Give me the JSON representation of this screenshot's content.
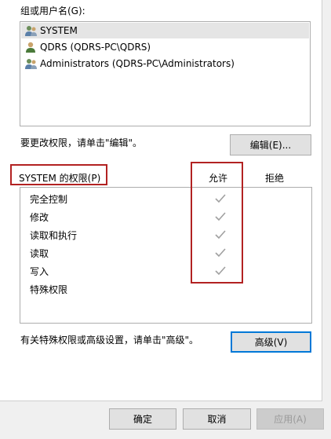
{
  "groups_label": "组或用户名(G):",
  "users": [
    {
      "name": "SYSTEM",
      "icon": "user-group-icon",
      "selected": true
    },
    {
      "name": "QDRS (QDRS-PC\\QDRS)",
      "icon": "user-icon",
      "selected": false
    },
    {
      "name": "Administrators (QDRS-PC\\Administrators)",
      "icon": "user-group-icon",
      "selected": false
    }
  ],
  "edit_hint": "要更改权限，请单击\"编辑\"。",
  "edit_button": "编辑(E)...",
  "permissions": {
    "title": "SYSTEM 的权限(P)",
    "allow_header": "允许",
    "deny_header": "拒绝",
    "rows": [
      {
        "name": "完全控制",
        "allow": true,
        "deny": false
      },
      {
        "name": "修改",
        "allow": true,
        "deny": false
      },
      {
        "name": "读取和执行",
        "allow": true,
        "deny": false
      },
      {
        "name": "读取",
        "allow": true,
        "deny": false
      },
      {
        "name": "写入",
        "allow": true,
        "deny": false
      },
      {
        "name": "特殊权限",
        "allow": false,
        "deny": false
      }
    ]
  },
  "advanced_hint": "有关特殊权限或高级设置，请单击\"高级\"。",
  "advanced_button": "高级(V)",
  "footer": {
    "ok": "确定",
    "cancel": "取消",
    "apply": "应用(A)"
  },
  "colors": {
    "highlight_box": "#b22222",
    "check_gray": "#a0a0a0",
    "focus_blue": "#0078d7"
  }
}
